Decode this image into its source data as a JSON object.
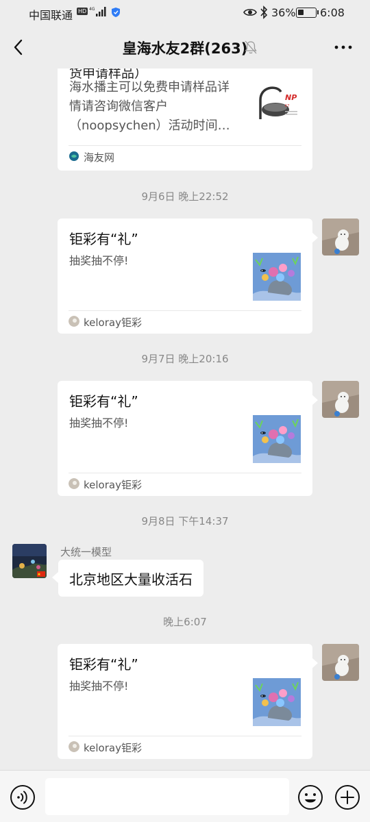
{
  "status_bar": {
    "carrier": "中国联通",
    "hd_badge": "HD",
    "battery_pct": "36%",
    "battery_level": 0.36,
    "time": "6:08"
  },
  "header": {
    "title": "皇海水友2群(263)"
  },
  "messages": {
    "card0": {
      "partial_title": "货申请样品）",
      "description": "海水播主可以免费申请样品详情请咨询微信客户（noopsychen）活动时间…",
      "source": "海友网"
    },
    "ts1": "9月6日 晚上22:52",
    "card1": {
      "title": "钜彩有“礼”",
      "description": "抽奖抽不停!",
      "source": "keloray钜彩"
    },
    "ts2": "9月7日 晚上20:16",
    "card2": {
      "title": "钜彩有“礼”",
      "description": "抽奖抽不停!",
      "source": "keloray钜彩"
    },
    "ts3": "9月8日 下午14:37",
    "text_msg": {
      "sender": "大统一模型",
      "text": "北京地区大量收活石"
    },
    "ts4": "晚上6:07",
    "card3": {
      "title": "钜彩有“礼”",
      "description": "抽奖抽不停!",
      "source": "keloray钜彩"
    }
  },
  "input": {
    "placeholder": ""
  },
  "colors": {
    "background": "#ededed",
    "bubble": "#ffffff",
    "input_bar": "#f6f6f6",
    "text_muted": "#888888"
  }
}
